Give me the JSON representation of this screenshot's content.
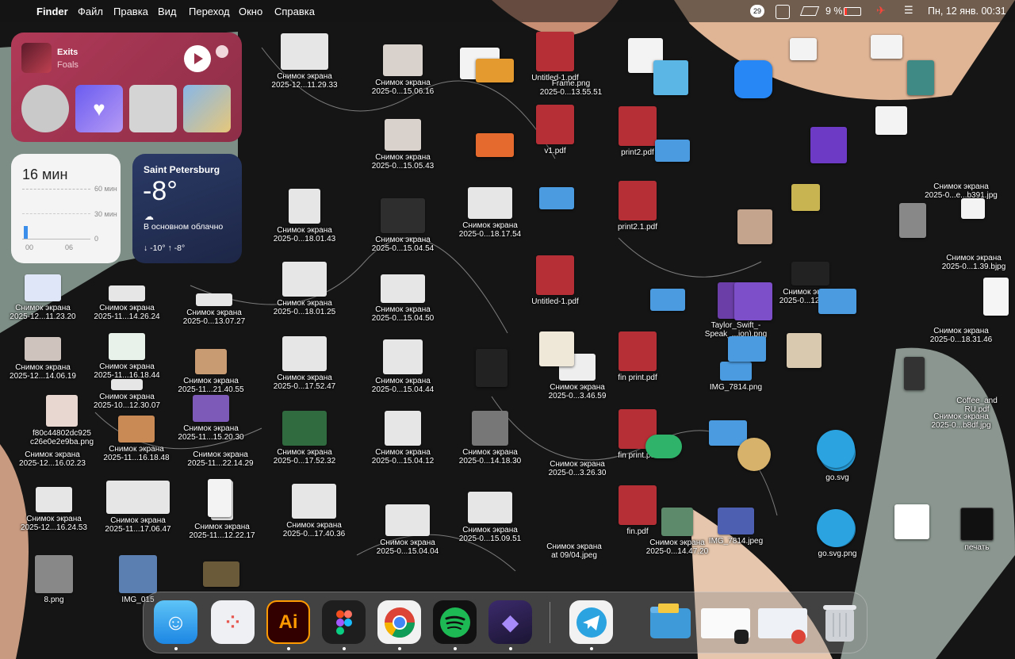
{
  "menubar": {
    "apple_icon": "apple-icon",
    "app_name": "Finder",
    "menus": [
      "Файл",
      "Правка",
      "Вид",
      "Переход",
      "Окно",
      "Справка"
    ],
    "notifications_badge": "29",
    "battery": "9 %",
    "datetime": "Пн, 12 янв.  00:31"
  },
  "music_widget": {
    "track": "Exits",
    "artist": "Foals"
  },
  "timer_widget": {
    "value": "16 мин",
    "axis_60": "60 мин",
    "axis_30": "30 мин",
    "axis_0": "0",
    "x_start": "00",
    "x_end": "06"
  },
  "weather_widget": {
    "city": "Saint Petersburg",
    "temperature": "-8°",
    "condition": "В основном облачно",
    "range": "↓ -10° ↑ -8°"
  },
  "desktop_files": [
    {
      "l1": "Снимок экрана",
      "l2": "2025-12...11.23.20"
    },
    {
      "l1": "Снимок экрана",
      "l2": "2025-11...14.26.24"
    },
    {
      "l1": "Снимок экрана",
      "l2": "2025-0...13.07.27"
    },
    {
      "l1": "Снимок экрана",
      "l2": "2025-12...14.06.19"
    },
    {
      "l1": "Снимок экрана",
      "l2": "2025-11...16.18.44"
    },
    {
      "l1": "Снимок экрана",
      "l2": "2025-11...21.40.55"
    },
    {
      "l1": "f80c44802dc925",
      "l2": "c26e0e2e9ba.png"
    },
    {
      "l1": "Снимок экрана",
      "l2": "2025-10...12.30.07"
    },
    {
      "l1": "Снимок экрана",
      "l2": "2025-11...15.20.30"
    },
    {
      "l1": "Снимок экрана",
      "l2": "2025-12...16.02.23"
    },
    {
      "l1": "Снимок экрана",
      "l2": "2025-11...16.18.48"
    },
    {
      "l1": "Снимок экрана",
      "l2": "2025-11...22.14.29"
    },
    {
      "l1": "Снимок экрана",
      "l2": "2025-12...16.24.53"
    },
    {
      "l1": "Снимок экрана",
      "l2": "2025-11...17.06.47"
    },
    {
      "l1": "Снимок экрана",
      "l2": "2025-11...12.22.17"
    },
    {
      "l1": "8.png",
      "l2": ""
    },
    {
      "l1": "IMG_015",
      "l2": ""
    },
    {
      "l1": "Снимок экрана",
      "l2": "2025-12...11.29.33"
    },
    {
      "l1": "Снимок экрана",
      "l2": "2025-0...15.06.16"
    },
    {
      "l1": "Снимок экрана",
      "l2": "2025-0...15.05.43"
    },
    {
      "l1": "Снимок экрана",
      "l2": "2025-0...18.01.43"
    },
    {
      "l1": "Снимок экрана",
      "l2": "2025-0...15.04.54"
    },
    {
      "l1": "Снимок экрана",
      "l2": "2025-0...18.17.54"
    },
    {
      "l1": "Снимок экрана",
      "l2": "2025-0...18.01.25"
    },
    {
      "l1": "Снимок экрана",
      "l2": "2025-0...15.04.50"
    },
    {
      "l1": "Снимок экрана",
      "l2": "2025-0...17.52.47"
    },
    {
      "l1": "Снимок экрана",
      "l2": "2025-0...15.04.44"
    },
    {
      "l1": "Снимок экрана",
      "l2": "2025-0...17.52.32"
    },
    {
      "l1": "Снимок экрана",
      "l2": "2025-0...15.04.12"
    },
    {
      "l1": "Снимок экрана",
      "l2": "2025-0...14.18.30"
    },
    {
      "l1": "Снимок экрана",
      "l2": "2025-0...17.40.36"
    },
    {
      "l1": "Снимок экрана",
      "l2": "2025-0...15.04.04"
    },
    {
      "l1": "Снимок экрана",
      "l2": "2025-0...15.09.51"
    },
    {
      "l1": "Untitled-1.pdf",
      "l2": ""
    },
    {
      "l1": "v1.pdf",
      "l2": ""
    },
    {
      "l1": "print2.pdf",
      "l2": ""
    },
    {
      "l1": "print2.1.pdf",
      "l2": ""
    },
    {
      "l1": "fin print.pdf",
      "l2": ""
    },
    {
      "l1": "fin print.pdf",
      "l2": ""
    },
    {
      "l1": "fin.pdf",
      "l2": ""
    },
    {
      "l1": "Untitled-1.pdf",
      "l2": ""
    },
    {
      "l1": "Снимок экрана",
      "l2": "2025-0...14.47.20"
    },
    {
      "l1": "Taylor_Swift_-",
      "l2": "Speak_...ion).png"
    },
    {
      "l1": "IMG_7814.png",
      "l2": ""
    },
    {
      "l1": "IMG_7814.jpeg",
      "l2": ""
    },
    {
      "l1": "Снимок экрана",
      "l2": "2025-0...12.18.32"
    },
    {
      "l1": "go.svg",
      "l2": ""
    },
    {
      "l1": "go.svg.png",
      "l2": ""
    },
    {
      "l1": "Снимок экрана",
      "l2": "2025-0...18.31.46"
    },
    {
      "l1": "Снимок экрана",
      "l2": "2025-0...e...b391.jpg"
    },
    {
      "l1": "Снимок экрана",
      "l2": "2025-0...b8df.jpg"
    },
    {
      "l1": "печать",
      "l2": ""
    },
    {
      "l1": "Снимок экрана",
      "l2": "2025-0...1.39.bjpg"
    },
    {
      "l1": "Coffee_and",
      "l2": "RU.pdf"
    },
    {
      "l1": "Снимок экрана",
      "l2": "2025-0...3.46.59"
    },
    {
      "l1": "Снимок экрана",
      "l2": "2025-0...3.26.30"
    },
    {
      "l1": "Frame.png",
      "l2": "2025-0...13.55.51"
    },
    {
      "l1": "Снимок экрана",
      "l2": "at 09/04.jpeg"
    }
  ],
  "dock": {
    "apps": [
      {
        "name": "Finder",
        "icon": "finder-icon"
      },
      {
        "name": "Launchpad",
        "icon": "launchpad-icon"
      },
      {
        "name": "Illustrator",
        "icon": "illustrator-icon",
        "glyph": "Ai"
      },
      {
        "name": "Figma",
        "icon": "figma-icon"
      },
      {
        "name": "Chrome",
        "icon": "chrome-icon"
      },
      {
        "name": "Spotify",
        "icon": "spotify-icon"
      },
      {
        "name": "Obsidian",
        "icon": "obsidian-icon"
      },
      {
        "name": "Telegram",
        "icon": "telegram-icon"
      },
      {
        "name": "Folder",
        "icon": "folder-icon"
      },
      {
        "name": "Figma window",
        "icon": "figma-window-icon"
      },
      {
        "name": "Chrome window",
        "icon": "chrome-window-icon"
      },
      {
        "name": "Trash",
        "icon": "trash-icon"
      }
    ]
  },
  "colors": {
    "music_bg": "#a93653",
    "weather_bg": "#24305a",
    "pdf_red": "#b72f36",
    "telegram_blue": "#2aa3e0",
    "spotify_green": "#1db954"
  }
}
